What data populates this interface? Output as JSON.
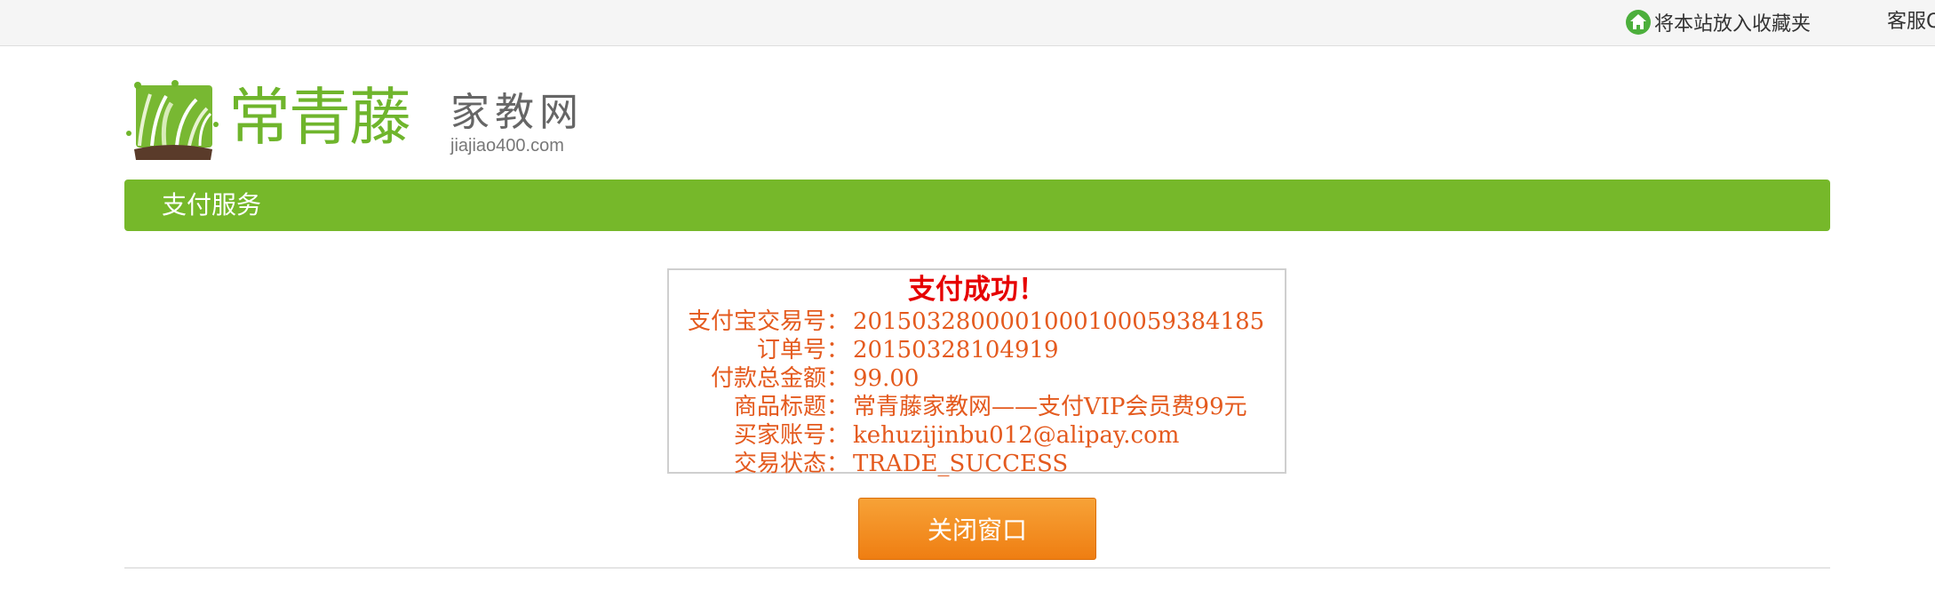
{
  "topbar": {
    "favorite_label": "将本站放入收藏夹",
    "service_label": "客服Q"
  },
  "logo": {
    "name_cn": "常青藤",
    "subtitle_cn": "家教网",
    "domain": "jiajiao400.com"
  },
  "section": {
    "title": "支付服务"
  },
  "result": {
    "title": "支付成功！",
    "rows": [
      {
        "label": "支付宝交易号：",
        "value": "2015032800001000100059384185"
      },
      {
        "label": "订单号：",
        "value": "20150328104919"
      },
      {
        "label": "付款总金额：",
        "value": "99.00"
      },
      {
        "label": "商品标题：",
        "value": "常青藤家教网——支付VIP会员费99元"
      },
      {
        "label": "买家账号：",
        "value": "kehuzijinbu012@alipay.com"
      },
      {
        "label": "交易状态：",
        "value": "TRADE_SUCCESS"
      }
    ]
  },
  "close_button_label": "关闭窗口",
  "colors": {
    "brand_green": "#76b82a",
    "logo_green": "#6fb52c",
    "success_red": "#e60000",
    "info_orange": "#e45a1e",
    "button_orange": "#f08a1c"
  },
  "icons": [
    "home-icon",
    "logo-grass-icon"
  ]
}
